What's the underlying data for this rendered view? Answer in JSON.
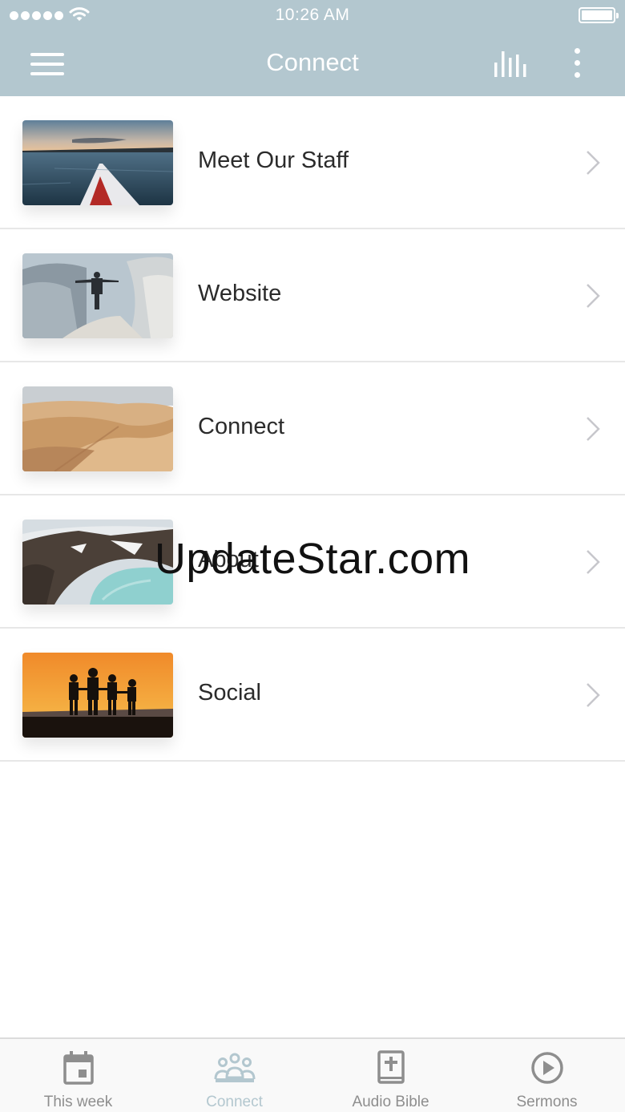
{
  "status_bar": {
    "time": "10:26 AM"
  },
  "nav": {
    "title": "Connect"
  },
  "list": {
    "items": [
      {
        "label": "Meet Our Staff",
        "thumbnail": "kayak-on-lake-image"
      },
      {
        "label": "Website",
        "thumbnail": "person-on-cliff-image"
      },
      {
        "label": "Connect",
        "thumbnail": "desert-dunes-image"
      },
      {
        "label": "About",
        "thumbnail": "crater-lake-image"
      },
      {
        "label": "Social",
        "thumbnail": "family-sunset-image"
      }
    ]
  },
  "watermark": {
    "text": "UpdateStar.com"
  },
  "tabbar": {
    "tabs": [
      {
        "label": "This week",
        "icon": "calendar-icon"
      },
      {
        "label": "Connect",
        "icon": "group-icon",
        "active": true
      },
      {
        "label": "Audio Bible",
        "icon": "bible-icon"
      },
      {
        "label": "Sermons",
        "icon": "play-circle-icon"
      }
    ]
  },
  "colors": {
    "header": "#b3c7cf",
    "active_tab": "#b3c7cf",
    "inactive_tab": "#8e8e8e",
    "text": "#2b2b2b",
    "divider": "#e7e7e7"
  }
}
